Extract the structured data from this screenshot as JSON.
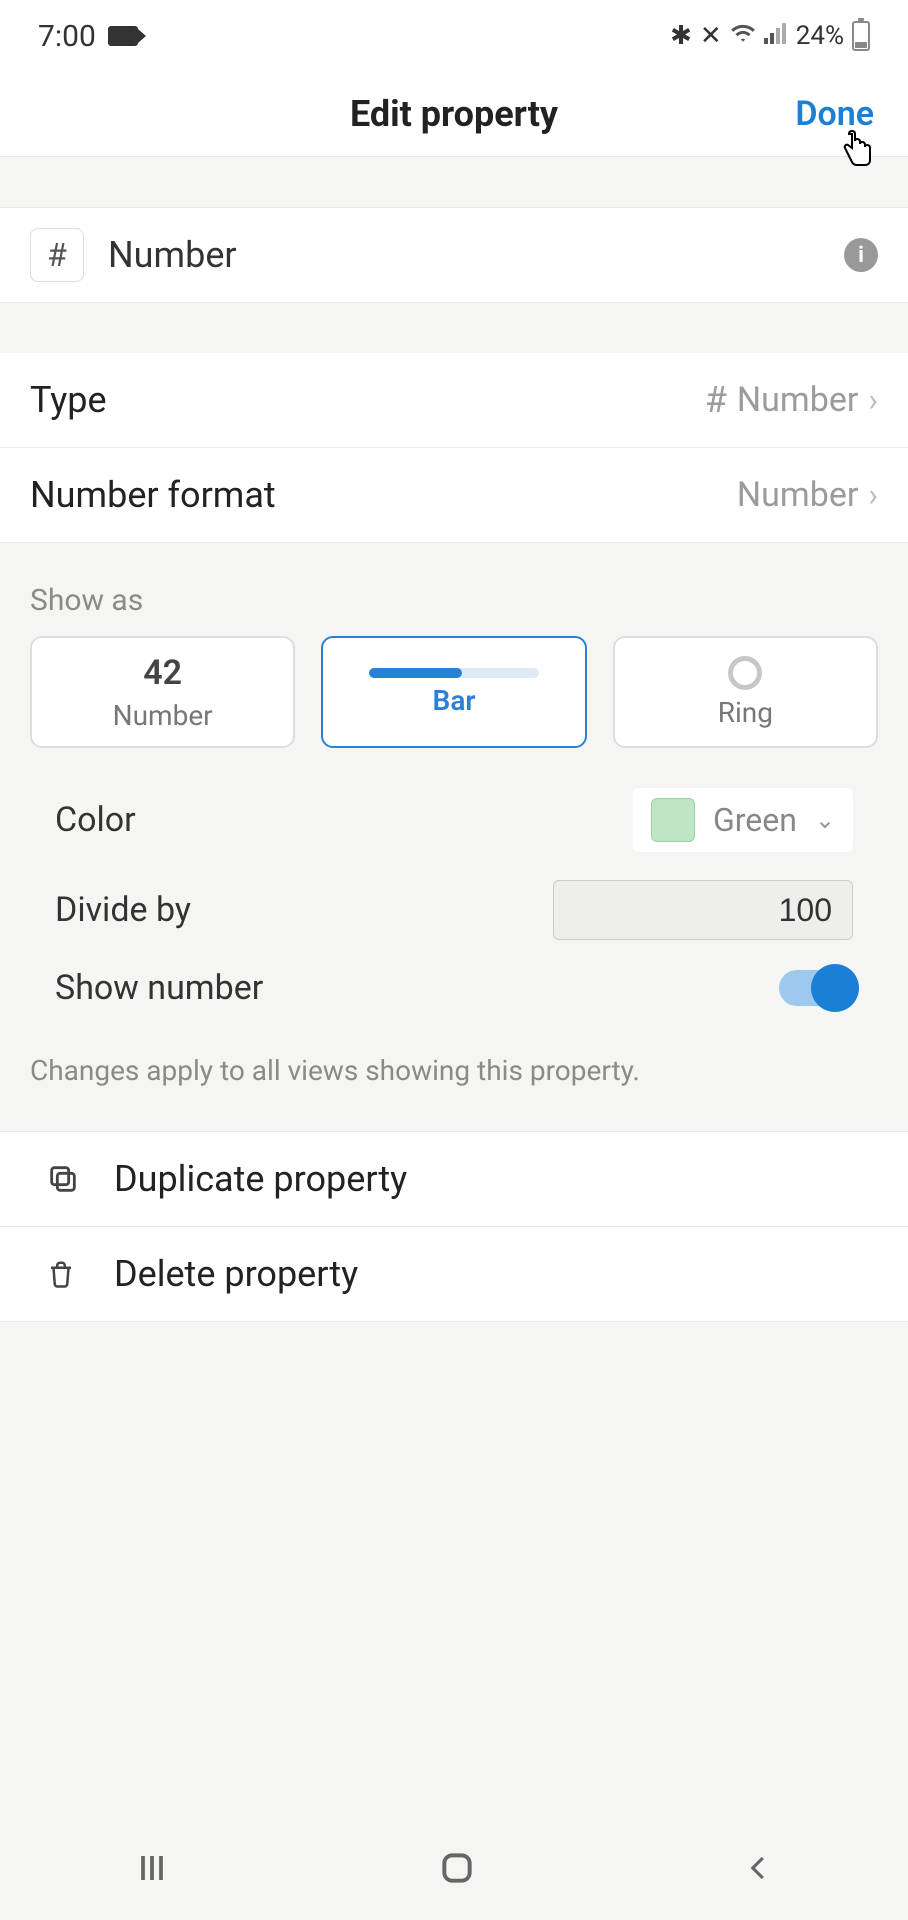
{
  "status": {
    "time": "7:00",
    "battery_pct": "24%"
  },
  "header": {
    "title": "Edit property",
    "done": "Done"
  },
  "property": {
    "icon_glyph": "#",
    "name": "Number"
  },
  "settings": {
    "type": {
      "label": "Type",
      "value": "Number",
      "icon_glyph": "#"
    },
    "format": {
      "label": "Number format",
      "value": "Number"
    }
  },
  "show_as": {
    "title": "Show as",
    "options": {
      "number": {
        "preview": "42",
        "label": "Number"
      },
      "bar": {
        "label": "Bar"
      },
      "ring": {
        "label": "Ring"
      }
    },
    "selected": "bar"
  },
  "sub": {
    "color": {
      "label": "Color",
      "value": "Green",
      "swatch_hex": "#bfe6c4"
    },
    "divide": {
      "label": "Divide by",
      "value": "100"
    },
    "show_number": {
      "label": "Show number",
      "on": true
    }
  },
  "hint": "Changes apply to all views showing this property.",
  "actions": {
    "duplicate": "Duplicate property",
    "delete": "Delete property"
  }
}
